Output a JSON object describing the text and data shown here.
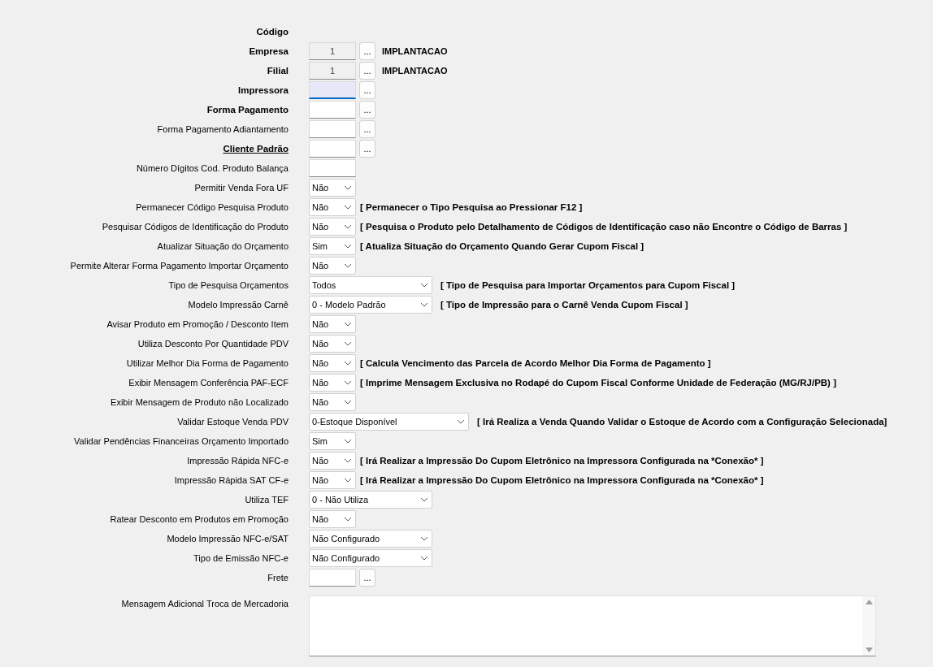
{
  "rows": [
    {
      "kind": "label",
      "label": "Código",
      "bold": true
    },
    {
      "kind": "lookup",
      "label": "Empresa",
      "bold": true,
      "value": "1",
      "disabled": true,
      "description": "IMPLANTACAO"
    },
    {
      "kind": "lookup",
      "label": "Filial",
      "bold": true,
      "value": "1",
      "disabled": true,
      "description": "IMPLANTACAO"
    },
    {
      "kind": "lookup",
      "label": "Impressora",
      "bold": true,
      "focused": true
    },
    {
      "kind": "lookup",
      "label": "Forma Pagamento",
      "bold": true
    },
    {
      "kind": "lookup",
      "label": "Forma Pagamento Adiantamento",
      "bold": false
    },
    {
      "kind": "lookup",
      "label": "Cliente Padrão",
      "bold": true,
      "underline": true
    },
    {
      "kind": "input",
      "label": "Número Dígitos Cod. Produto Balança",
      "bold": false
    },
    {
      "kind": "select",
      "label": "Permitir Venda Fora UF",
      "bold": false,
      "value": "Não"
    },
    {
      "kind": "select",
      "label": "Permanecer Código Pesquisa Produto",
      "bold": false,
      "value": "Não",
      "note": "[ Permanecer o Tipo Pesquisa ao Pressionar F12 ]"
    },
    {
      "kind": "select",
      "label": "Pesquisar Códigos de Identificação do Produto",
      "bold": false,
      "value": "Não",
      "note": "[ Pesquisa o Produto pelo Detalhamento de Códigos de Identificação caso não Encontre o Código de Barras ]"
    },
    {
      "kind": "select",
      "label": "Atualizar Situação do Orçamento",
      "bold": false,
      "value": "Sim",
      "note": "[ Atualiza Situação do Orçamento Quando Gerar Cupom Fiscal ]"
    },
    {
      "kind": "select",
      "label": "Permite Alterar Forma Pagamento Importar Orçamento",
      "bold": false,
      "value": "Não"
    },
    {
      "kind": "wide-select",
      "label": "Tipo de Pesquisa Orçamentos",
      "bold": false,
      "value": "Todos",
      "note": "[ Tipo de Pesquisa para Importar Orçamentos para Cupom Fiscal ]"
    },
    {
      "kind": "wide-select",
      "label": "Modelo Impressão Carnê",
      "bold": false,
      "value": "0 - Modelo Padrão",
      "note": "[ Tipo de Impressão para o Carnê Venda Cupom Fiscal ]"
    },
    {
      "kind": "select",
      "label": "Avisar Produto em Promoção / Desconto Item",
      "bold": false,
      "value": "Não"
    },
    {
      "kind": "select",
      "label": "Utiliza Desconto Por Quantidade PDV",
      "bold": false,
      "value": "Não"
    },
    {
      "kind": "select",
      "label": "Utilizar Melhor Dia Forma de Pagamento",
      "bold": false,
      "value": "Não",
      "note": "[ Calcula Vencimento das Parcela de Acordo Melhor Dia Forma de Pagamento ]"
    },
    {
      "kind": "select",
      "label": "Exibir Mensagem Conferência PAF-ECF",
      "bold": false,
      "value": "Não",
      "note": "[ Imprime Mensagem Exclusiva no Rodapé do Cupom Fiscal Conforme Unidade de Federação (MG/RJ/PB) ]"
    },
    {
      "kind": "select",
      "label": "Exibir Mensagem de Produto não Localizado",
      "bold": false,
      "value": "Não"
    },
    {
      "kind": "wider-select",
      "label": "Validar Estoque Venda PDV",
      "bold": false,
      "value": "0-Estoque Disponível",
      "note": "[ Irá Realiza a Venda Quando Validar o Estoque  de Acordo com a Configuração Selecionada]"
    },
    {
      "kind": "select",
      "label": "Validar Pendências Financeiras Orçamento Importado",
      "bold": false,
      "value": "Sim"
    },
    {
      "kind": "select",
      "label": "Impressão Rápida NFC-e",
      "bold": false,
      "value": "Não",
      "note": "[ Irá Realizar a Impressão Do Cupom Eletrônico na Impressora Configurada na *Conexão* ]"
    },
    {
      "kind": "select",
      "label": "Impressão Rápida SAT CF-e",
      "bold": false,
      "value": "Não",
      "note": "[ Irá Realizar a Impressão Do Cupom Eletrônico na Impressora Configurada na *Conexão* ]"
    },
    {
      "kind": "wide-select",
      "label": "Utiliza TEF",
      "bold": false,
      "value": "0 - Não Utiliza"
    },
    {
      "kind": "select",
      "label": "Ratear Desconto em Produtos em Promoção",
      "bold": false,
      "value": "Não"
    },
    {
      "kind": "wide-select",
      "label": "Modelo Impressão NFC-e/SAT",
      "bold": false,
      "value": "Não Configurado"
    },
    {
      "kind": "wide-select",
      "label": "Tipo de Emissão NFC-e",
      "bold": false,
      "value": "Não Configurado"
    },
    {
      "kind": "lookup",
      "label": "Frete",
      "bold": false
    },
    {
      "kind": "textarea",
      "label": "Mensagem Adicional Troca de Mercadoria",
      "bold": false
    }
  ],
  "lookup_button": "..."
}
